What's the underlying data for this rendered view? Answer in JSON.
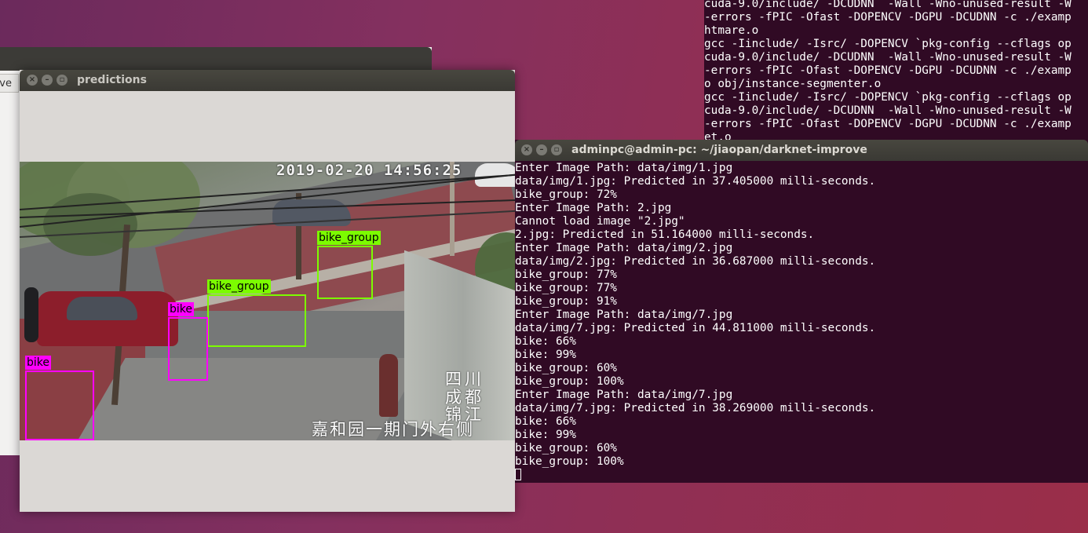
{
  "background_terminal": {
    "lines": [
      "cuda-9.0/include/ -DCUDNN  -Wall -Wno-unused-result -W",
      "-errors -fPIC -Ofast -DOPENCV -DGPU -DCUDNN -c ./examp",
      "htmare.o",
      "gcc -Iinclude/ -Isrc/ -DOPENCV `pkg-config --cflags op",
      "cuda-9.0/include/ -DCUDNN  -Wall -Wno-unused-result -W",
      "-errors -fPIC -Ofast -DOPENCV -DGPU -DCUDNN -c ./examp",
      "o obj/instance-segmenter.o",
      "gcc -Iinclude/ -Isrc/ -DOPENCV `pkg-config --cflags op",
      "cuda-9.0/include/ -DCUDNN  -Wall -Wno-unused-result -W",
      "-errors -fPIC -Ofast -DOPENCV -DGPU -DCUDNN -c ./examp",
      "et.o"
    ]
  },
  "back_window": {
    "tab_label": "ve"
  },
  "predictions_window": {
    "title": "predictions",
    "timestamp": "2019-02-20 14:56:25",
    "osd_lines": [
      "四川",
      "成都",
      "锦江"
    ],
    "osd_bottom": "嘉和园一期门外右侧",
    "detections": [
      {
        "label": "bike_group",
        "color": "#7cfc00"
      },
      {
        "label": "bike_group",
        "color": "#7cfc00"
      },
      {
        "label": "bike",
        "color": "#ff00ff"
      },
      {
        "label": "bike",
        "color": "#ff00ff"
      }
    ]
  },
  "terminal": {
    "title": "adminpc@admin-pc: ~/jiaopan/darknet-improve",
    "lines": [
      "Enter Image Path: data/img/1.jpg",
      "data/img/1.jpg: Predicted in 37.405000 milli-seconds.",
      "bike_group: 72%",
      "Enter Image Path: 2.jpg",
      "Cannot load image \"2.jpg\"",
      "2.jpg: Predicted in 51.164000 milli-seconds.",
      "Enter Image Path: data/img/2.jpg",
      "data/img/2.jpg: Predicted in 36.687000 milli-seconds.",
      "bike_group: 77%",
      "bike_group: 77%",
      "bike_group: 91%",
      "Enter Image Path: data/img/7.jpg",
      "data/img/7.jpg: Predicted in 44.811000 milli-seconds.",
      "bike: 66%",
      "bike: 99%",
      "bike_group: 60%",
      "bike_group: 100%",
      "Enter Image Path: data/img/7.jpg",
      "data/img/7.jpg: Predicted in 38.269000 milli-seconds.",
      "bike: 66%",
      "bike: 99%",
      "bike_group: 60%",
      "bike_group: 100%"
    ]
  },
  "icons": [
    "close-icon",
    "minimize-icon",
    "maximize-icon",
    "cursor-block"
  ]
}
